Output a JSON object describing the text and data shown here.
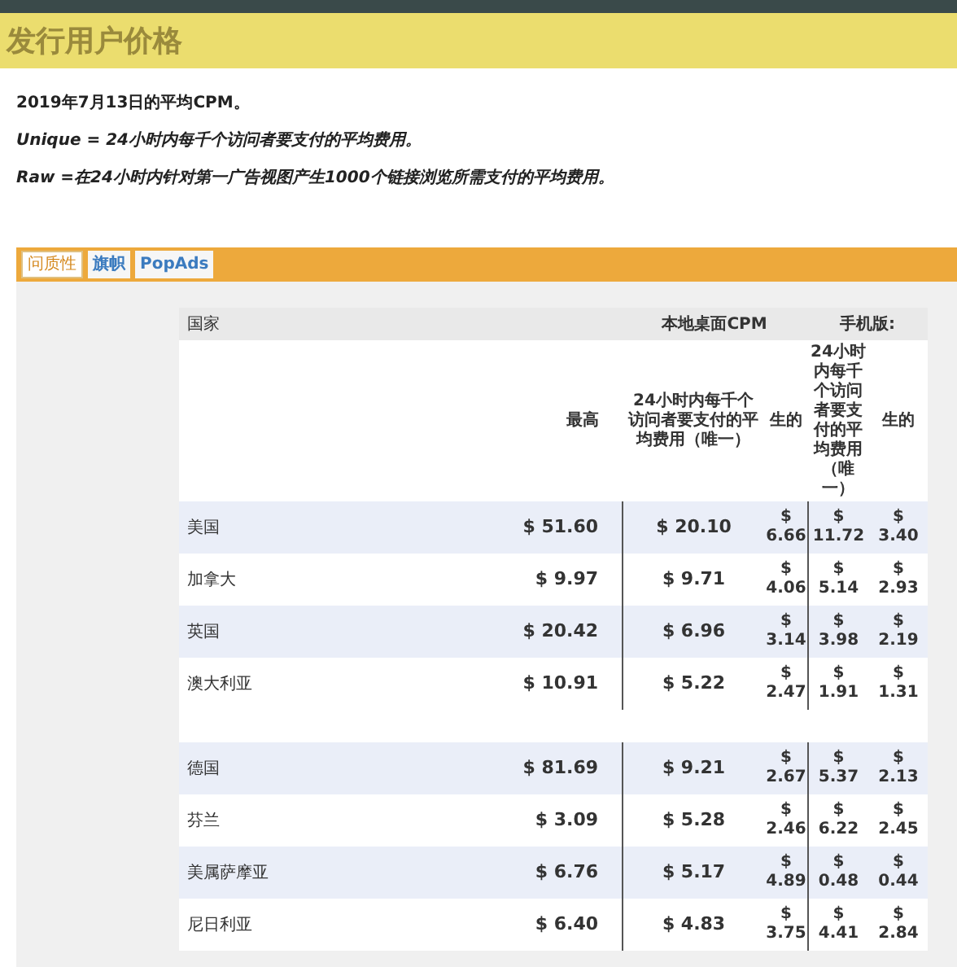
{
  "page_title": "发行用户价格",
  "notes": [
    {
      "text": "2019年7月13日的平均CPM。",
      "kind": "plain"
    },
    {
      "text": "Unique = 24小时内每千个访问者要支付的平均费用。",
      "kind": "italic"
    },
    {
      "text": "Raw =在24小时内针对第一广告视图产生1000个链接浏览所需支付的平均费用。",
      "kind": "italic"
    }
  ],
  "tabs": [
    {
      "label": "问质性",
      "selected": true
    },
    {
      "label": "旗帜",
      "selected": false
    },
    {
      "label": "PopAds",
      "selected": false
    }
  ],
  "table": {
    "country_header": "国家",
    "desktop_header": "本地桌面CPM",
    "mobile_header": "手机版:",
    "columns": [
      "最高",
      "24小时内每千个访问者要支付的平均费用（唯一）",
      "生的",
      "24小时内每千个访问者要支付的平均费用（唯一）",
      "生的"
    ],
    "row_groups": [
      {
        "rows": [
          {
            "country": "美国",
            "values": [
              "$ 51.60",
              "$ 20.10",
              "$ 6.66",
              "$ 11.72",
              "$ 3.40"
            ]
          },
          {
            "country": "加拿大",
            "values": [
              "$ 9.97",
              "$ 9.71",
              "$ 4.06",
              "$ 5.14",
              "$ 2.93"
            ]
          },
          {
            "country": "英国",
            "values": [
              "$ 20.42",
              "$ 6.96",
              "$ 3.14",
              "$ 3.98",
              "$ 2.19"
            ]
          },
          {
            "country": "澳大利亚",
            "values": [
              "$ 10.91",
              "$ 5.22",
              "$ 2.47",
              "$ 1.91",
              "$ 1.31"
            ]
          }
        ]
      },
      {
        "rows": [
          {
            "country": "德国",
            "values": [
              "$ 81.69",
              "$ 9.21",
              "$ 2.67",
              "$ 5.37",
              "$ 2.13"
            ]
          },
          {
            "country": "芬兰",
            "values": [
              "$ 3.09",
              "$ 5.28",
              "$ 2.46",
              "$ 6.22",
              "$ 2.45"
            ]
          },
          {
            "country": "美属萨摩亚",
            "values": [
              "$ 6.76",
              "$ 5.17",
              "$ 4.89",
              "$ 0.48",
              "$ 0.44"
            ]
          },
          {
            "country": "尼日利亚",
            "values": [
              "$ 6.40",
              "$ 4.83",
              "$ 3.75",
              "$ 4.41",
              "$ 2.84"
            ]
          }
        ]
      }
    ]
  }
}
